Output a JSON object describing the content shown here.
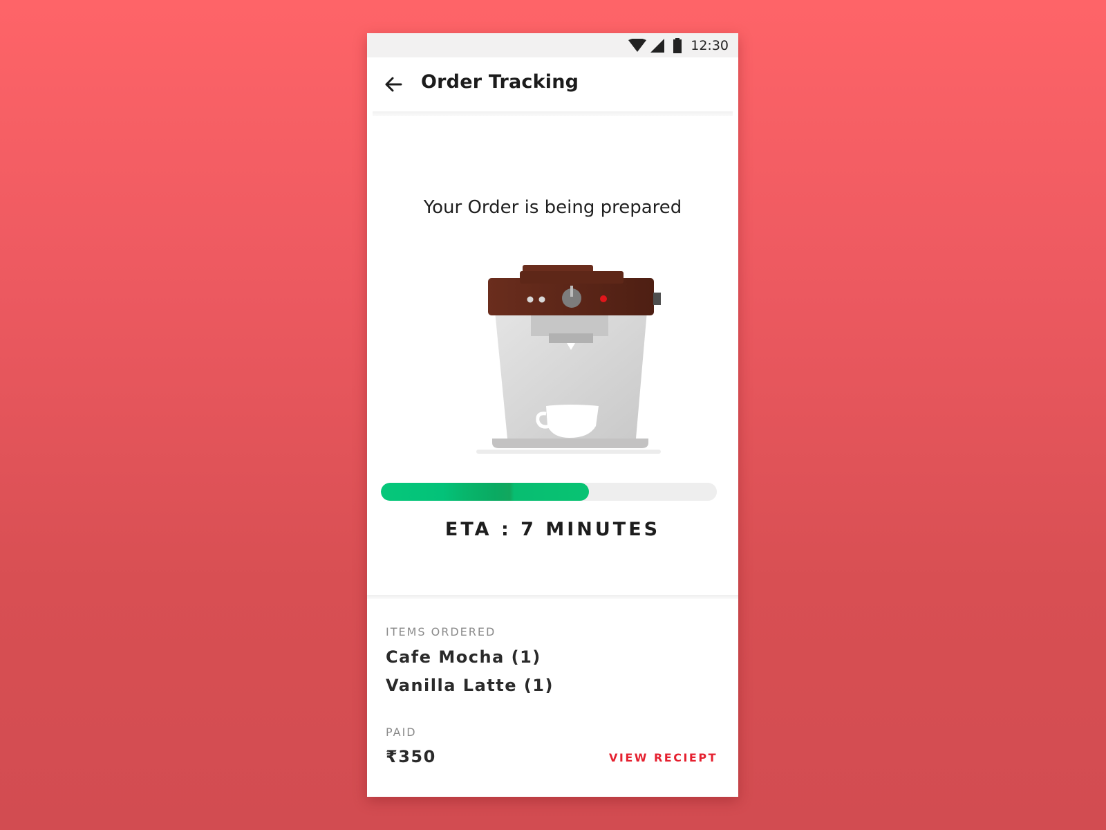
{
  "status_bar": {
    "time": "12:30",
    "icons": [
      "wifi-icon",
      "cell-signal-icon",
      "battery-icon"
    ]
  },
  "header": {
    "back_icon": "arrow-back-icon",
    "title": "Order Tracking"
  },
  "order": {
    "status_heading": "Your Order is being prepared",
    "illustration": "coffee-machine-illustration",
    "progress_fraction": 0.62,
    "eta_text": "ETA : 7 MINUTES"
  },
  "items_section": {
    "label": "ITEMS ORDERED",
    "items": [
      "Cafe Mocha (1)",
      "Vanilla Latte (1)"
    ]
  },
  "payment": {
    "label": "PAID",
    "amount": "₹350",
    "view_receipt_label": "VIEW RECIEPT"
  },
  "colors": {
    "background_top": "#fe6468",
    "background_bottom": "#d24c51",
    "progress_green": "#06c77a",
    "accent_red": "#e5202f"
  }
}
